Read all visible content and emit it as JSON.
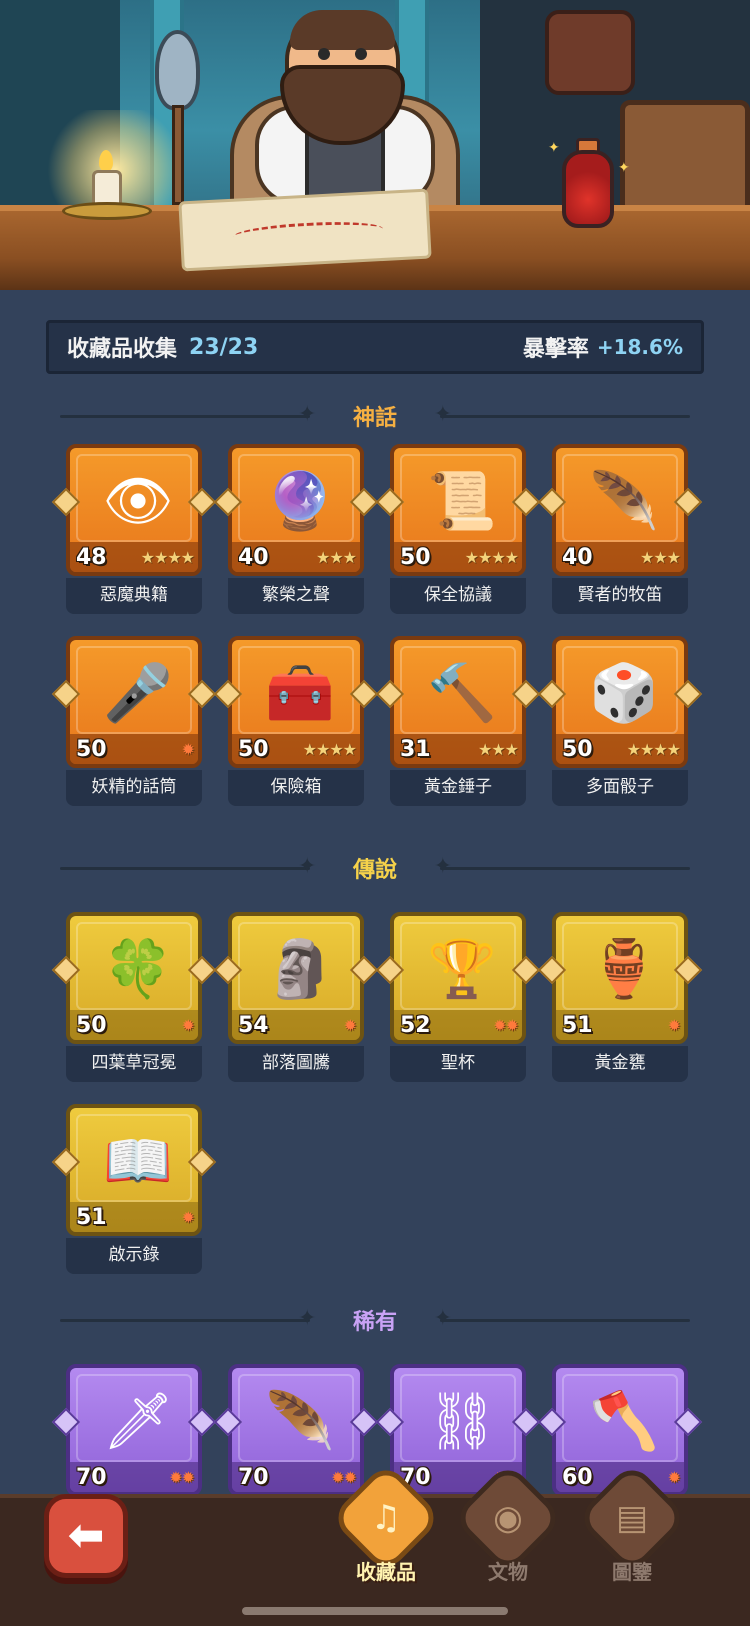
{
  "summary": {
    "label": "收藏品收集",
    "count": "23/23",
    "crit_label": "暴擊率",
    "crit_value": "+18.6%"
  },
  "sections": {
    "mythic": "神話",
    "legend": "傳說",
    "rare": "稀有"
  },
  "colors": {
    "mythic_title": "#f6b042",
    "legend_title": "#f6d24a",
    "rare_title": "#c9a2f5"
  },
  "mythic_items": [
    {
      "name": "惡魔典籍",
      "level": "48",
      "stars": "★★★★",
      "icon": "demon-book-icon",
      "glyph": "👁"
    },
    {
      "name": "繁榮之聲",
      "level": "40",
      "stars": "★★★",
      "icon": "prosperity-orb-icon",
      "glyph": "🔮"
    },
    {
      "name": "保全協議",
      "level": "50",
      "stars": "★★★★",
      "icon": "contract-scroll-icon",
      "glyph": "📜"
    },
    {
      "name": "賢者的牧笛",
      "level": "40",
      "stars": "★★★",
      "icon": "flute-icon",
      "glyph": "🪶"
    },
    {
      "name": "妖精的話筒",
      "level": "50",
      "stars": "✹",
      "icon": "fairy-microphone-icon",
      "glyph": "🎤"
    },
    {
      "name": "保險箱",
      "level": "50",
      "stars": "★★★★",
      "icon": "treasure-chest-icon",
      "glyph": "🧰"
    },
    {
      "name": "黃金錘子",
      "level": "31",
      "stars": "★★★",
      "icon": "golden-hammer-icon",
      "glyph": "🔨"
    },
    {
      "name": "多面骰子",
      "level": "50",
      "stars": "★★★★",
      "icon": "dice-icon",
      "glyph": "🎲"
    }
  ],
  "legend_items": [
    {
      "name": "四葉草冠冕",
      "level": "50",
      "stars": "✹",
      "icon": "clover-crown-icon",
      "glyph": "🍀"
    },
    {
      "name": "部落圖騰",
      "level": "54",
      "stars": "✹",
      "icon": "tribal-totem-icon",
      "glyph": "🗿"
    },
    {
      "name": "聖杯",
      "level": "52",
      "stars": "✹✹",
      "icon": "holy-grail-icon",
      "glyph": "🏆"
    },
    {
      "name": "黃金甕",
      "level": "51",
      "stars": "✹",
      "icon": "golden-urn-icon",
      "glyph": "🏺"
    },
    {
      "name": "啟示錄",
      "level": "51",
      "stars": "✹",
      "icon": "revelation-book-icon",
      "glyph": "📖"
    }
  ],
  "rare_items": [
    {
      "name": "",
      "level": "70",
      "stars": "✹✹",
      "icon": "ice-dagger-icon",
      "glyph": "🗡"
    },
    {
      "name": "",
      "level": "70",
      "stars": "✹✹",
      "icon": "fire-feather-icon",
      "glyph": "🪶"
    },
    {
      "name": "",
      "level": "70",
      "stars": "✹✹",
      "icon": "thorn-shackles-icon",
      "glyph": "⛓"
    },
    {
      "name": "",
      "level": "60",
      "stars": "✹",
      "icon": "stone-axe-icon",
      "glyph": "🪓"
    }
  ],
  "nav": {
    "back_icon": "back-arrow-icon",
    "items": [
      {
        "label": "收藏品",
        "icon": "lyre-icon",
        "glyph": "♫"
      },
      {
        "label": "文物",
        "icon": "eye-icon",
        "glyph": "◉"
      },
      {
        "label": "圖鑒",
        "icon": "book-icon",
        "glyph": "▤"
      }
    ]
  }
}
